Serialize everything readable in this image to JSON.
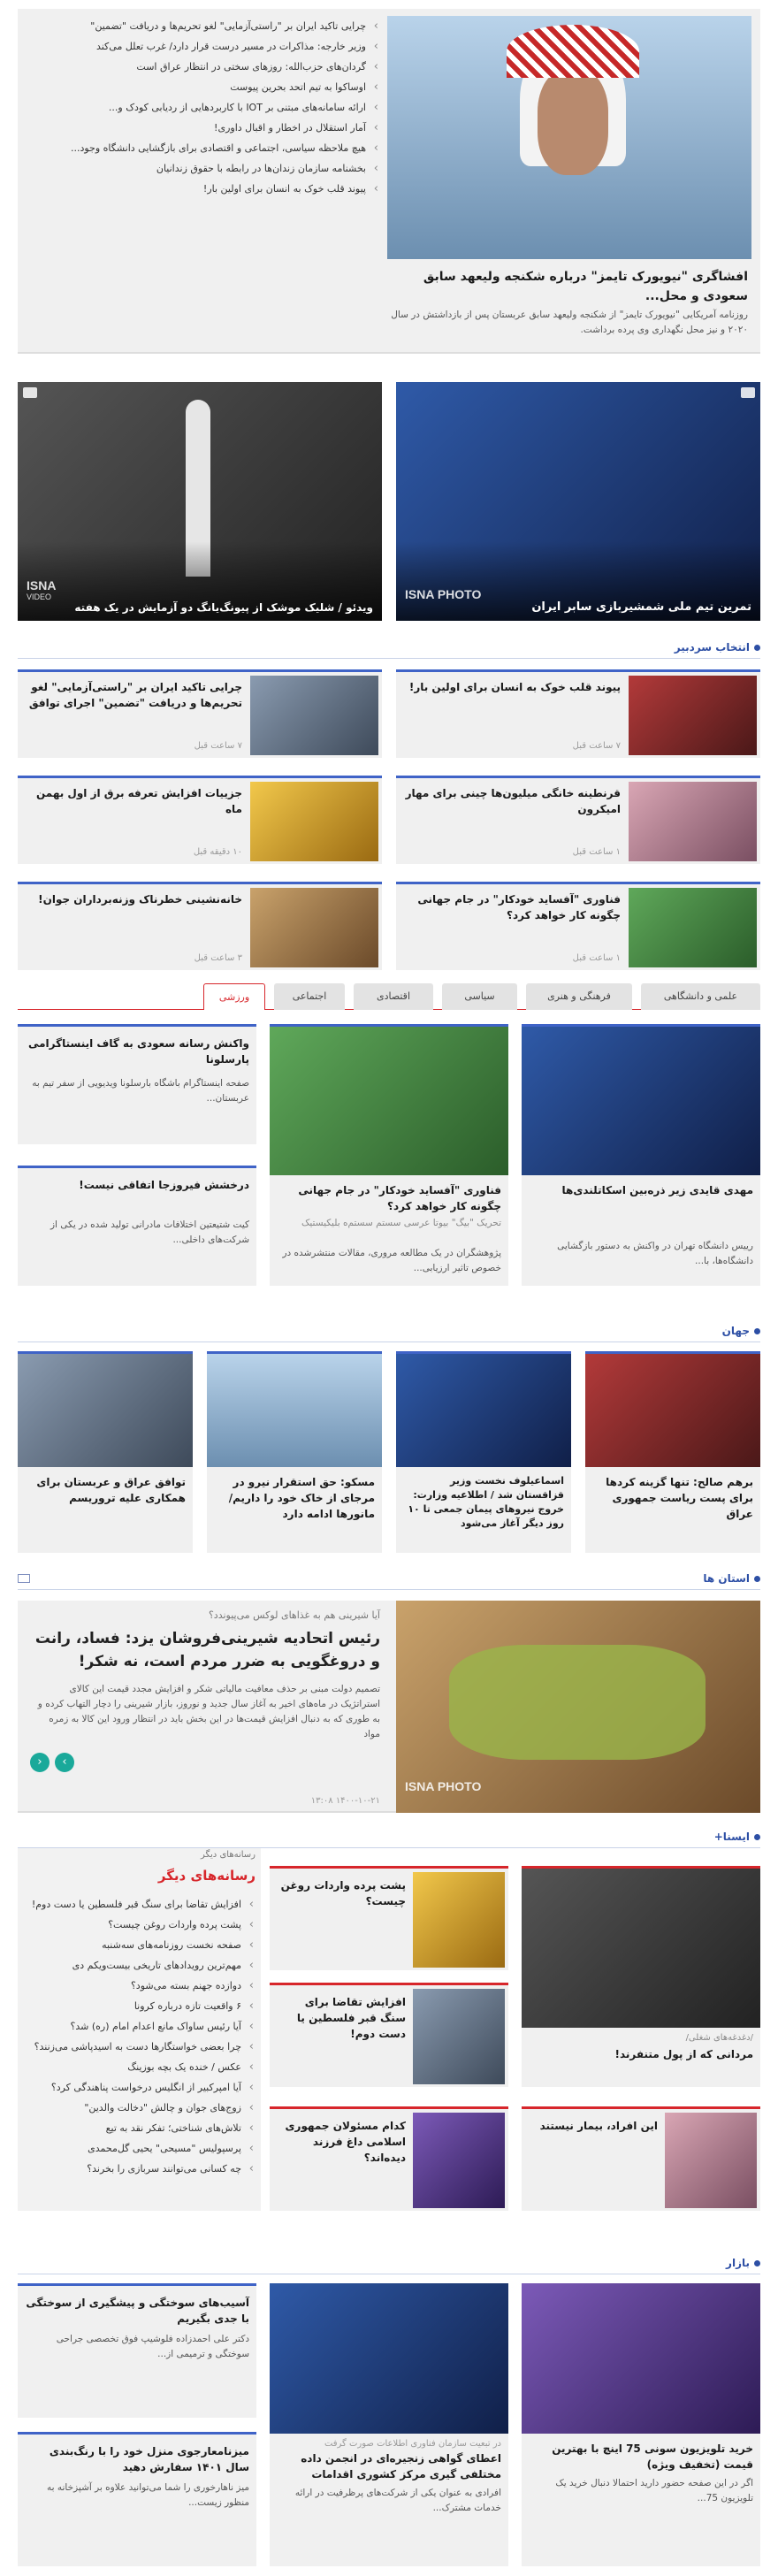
{
  "top": {
    "hero_title": "افشاگری \"نیویورک تایمز\" درباره شکنجه ولیعهد سابق سعودی و محل...",
    "hero_lead": "روزنامه آمریکایی \"نیویورک تایمز\" از شکنجه ولیعهد سابق عربستان پس از بازداشتش در سال ۲۰۲۰ و نیز محل نگهداری وی پرده برداشت.",
    "list": [
      "چرایی تاکید ایران بر \"راستی‌آزمایی\" لغو تحریم‌ها و دریافت \"تضمین\"",
      "وزیر خارجه: مذاکرات در مسیر درست قرار دارد/ غرب تعلل می‌کند",
      "گردان‌های حزب‌الله: روزهای سختی در انتظار عراق است",
      "اوساکوا به تیم اتحد بحرین پیوست",
      "ارائه سامانه‌های مبتنی بر IOT با کاربردهایی از ردیابی کودک و...",
      "آمار استقلال در اخطار و اقبال داوری!",
      "هیچ ملاحظه سیاسی، اجتماعی و اقتصادی برای بازگشایی دانشگاه وجود...",
      "بخشنامه سازمان زندان‌ها در رابطه با حقوق زندانیان",
      "پیوند قلب خوک به انسان برای اولین بار!"
    ]
  },
  "media": {
    "photo_caption": "تمرین تیم ملی شمشیربازی سابر ایران",
    "video_caption": "ویدئو / شلیک موشک از پیونگ‌یانگ دو آزمایش در یک هفته",
    "isna_photo": "ISNA PHOTO",
    "isna_video": "ISNA",
    "isna_video_sub": "VIDEO"
  },
  "editors": {
    "heading": "انتخاب سردبیر",
    "items": [
      {
        "title": "پیوند قلب خوک به انسان برای اولین بار!",
        "time": "۷ ساعت قبل"
      },
      {
        "title": "چرایی تاکید ایران بر \"راستی‌آزمایی\" لغو تحریم‌ها و دریافت \"تضمین\" اجرای توافق",
        "time": "۷ ساعت قبل"
      },
      {
        "title": "قرنطینه خانگی میلیون‌ها چینی برای مهار امیکرون",
        "time": "۱ ساعت قبل"
      },
      {
        "title": "جزییات افزایش تعرفه برق از اول بهمن ماه",
        "time": "۱۰ دقیقه قبل"
      },
      {
        "title": "فناوری \"آفساید خودکار\" در جام جهانی چگونه کار خواهد کرد؟",
        "time": "۱ ساعت قبل"
      },
      {
        "title": "خانه‌نشینی خطرناک وزنه‌برداران جوان!",
        "time": "۳ ساعت قبل"
      }
    ]
  },
  "tabs": {
    "labels": [
      "علمی و دانشگاهی",
      "فرهنگی و هنری",
      "سیاسی",
      "اقتصادی",
      "اجتماعی",
      "ورزشی"
    ],
    "main_title": "مهدی قایدی زیر ذره‌بین اسکاتلندی‌ها",
    "main_lead": "رییس دانشگاه تهران در واکنش به دستور بازگشایی دانشگاه‌ها، با...",
    "mid_title": "فناوری \"آفساید خودکار\" در جام جهانی چگونه کار خواهد کرد؟",
    "mid_lead": "پژوهشگران در یک مطالعه مروری، مقالات منتشرشده در خصوص تاثیر ارزیابی...",
    "mid_sub": "تحریک‌ \"بیگ\" بیوتا عرسی سستم سستم‌ه بلیکیستیک",
    "left1_title": "واکنش رسانه سعودی به گاف اینستاگرامی پارسلونا",
    "left1_lead": "صفحه اینستاگرام باشگاه بارسلونا ویدیویی از سفر تیم به عربستان...",
    "left2_title": "درخشش فیروزجا اتفاقی نیست!",
    "left2_lead": "کیت شتیعتین اختلافات مادرانی تولید شده در یکی از شرکت‌های داخلی..."
  },
  "world": {
    "heading": "جهان",
    "items": [
      "برهم صالح: تنها گزینه کردها برای پست ریاست جمهوری عراق",
      "اسماعیلوف نخست وزیر قزاقستان شد / اطلاعیه وزارت: خروج نیروهای پیمان جمعی تا ۱۰ روز دیگر آغاز می‌شود",
      "مسکو: حق استقرار نیرو در مرجای از خاک خود را داریم/ مانورها ادامه دارد",
      "توافق عراق و عربستان برای همکاری علیه تروریسم"
    ]
  },
  "provinces": {
    "heading": "استان ها",
    "kicker": "آیا شیرینی هم به غذاهای لوکس می‌پیوندد؟",
    "title": "رئیس اتحادیه شیرینی‌فروشان یزد: فساد، رانت و دروغگویی به ضرر مردم است، نه شکر!",
    "lead": "تصمیم دولت مبنی بر حذف معافیت مالیاتی شکر و افزایش مجدد قیمت این کالای استراتژیک در ماه‌های اخیر به آغاز سال جدید و نوروز، بازار شیرینی را دچار التهاب کرده و به طوری که به دنبال افزایش قیمت‌ها در این بخش باید در انتظار ورود این کالا به زمره مواد",
    "date": "۱۴۰۰-۱۰-۲۱ ۱۳:۰۸"
  },
  "isna": {
    "heading": "ایسنا+",
    "c1_kicker": "/دغدغه‌های شغلی/",
    "c1_title": "مردانی که از پول متنفرند!",
    "c2_title": "پشت پرده واردات روغن چیست؟",
    "c3_title": "افزایش تقاضا برای سنگ قبر فلسطین یا دست دوم!",
    "c4_title": "این افراد، بیمار نیستند",
    "c5_title": "کدام مسئولان جمهوری اسلامی داغ فرزند دیده‌اند؟",
    "other_heading": "رسانه‌های دیگر",
    "other_tag": "رسانه‌های دیگر",
    "other_list": [
      "افزایش تقاضا برای سنگ قبر فلسطین یا دست دوم!",
      "پشت پرده واردات روغن چیست؟",
      "صفحه نخست روزنامه‌های سه‌شنبه",
      "مهم‌ترین رویدادهای تاریخی بیست‌ویکم دی",
      "دوازده جهنم بسته می‌شود؟",
      "۶ واقعیت تازه درباره کرونا",
      "آیا رئیس ساواک مانع اعدام امام (ره) شد؟",
      "چرا بعضی خواستگارها دست به اسیدپاشی می‌زنند؟",
      "عکس / خنده یک بچه بوزینگ",
      "آیا امپرکبیر از انگلیس درخواست پناهندگی کرد؟",
      "زوج‌های جوان و چالش \"دخالت والدین\"",
      "تلاش‌های شناختی؛ تفکر نقد به تیع",
      "پرسپولیس \"مسیحی\" یحیی گل‌محمدی",
      "چه کسانی می‌توانند سربازی را بخرند؟"
    ]
  },
  "bazar": {
    "heading": "بازار",
    "c1_title": "خرید تلویزیون سونی 75 اینچ با بهترین قیمت (تخفیف ویژه)",
    "c1_lead": "اگر در این صفحه حضور دارید احتمالا دنبال خرید یک تلویزیون 75...",
    "c2_title": "اعطای گواهی زنجیره‌ای در انجمن داده مختلفی گیری مرکز کشوری اقدامات",
    "c2_lead": "افرادی به عنوان یکی از شرکت‌های پرظرفیت در ارائه خدمات مشترک...",
    "c2_kicker": "در تبعیت سازمان فناوری اطلاعات صورت گرفت",
    "c3_title": "آسیب‌های سوختگی و پیشگیری از سوختگی با جدی بگیریم",
    "c3_lead": "دکتر علی احمدزاده فلوشیپ فوق تخصصی جراحی سوختگی و ترمیمی از...",
    "c4_title": "میزنامعارجوی منزل خود را با رنگ‌بندی سال ۱۴۰۱ سفارش دهید",
    "c4_lead": "میز ناهارخوری را شما می‌توانید علاوه بر آشپزخانه به منظور زیست..."
  }
}
